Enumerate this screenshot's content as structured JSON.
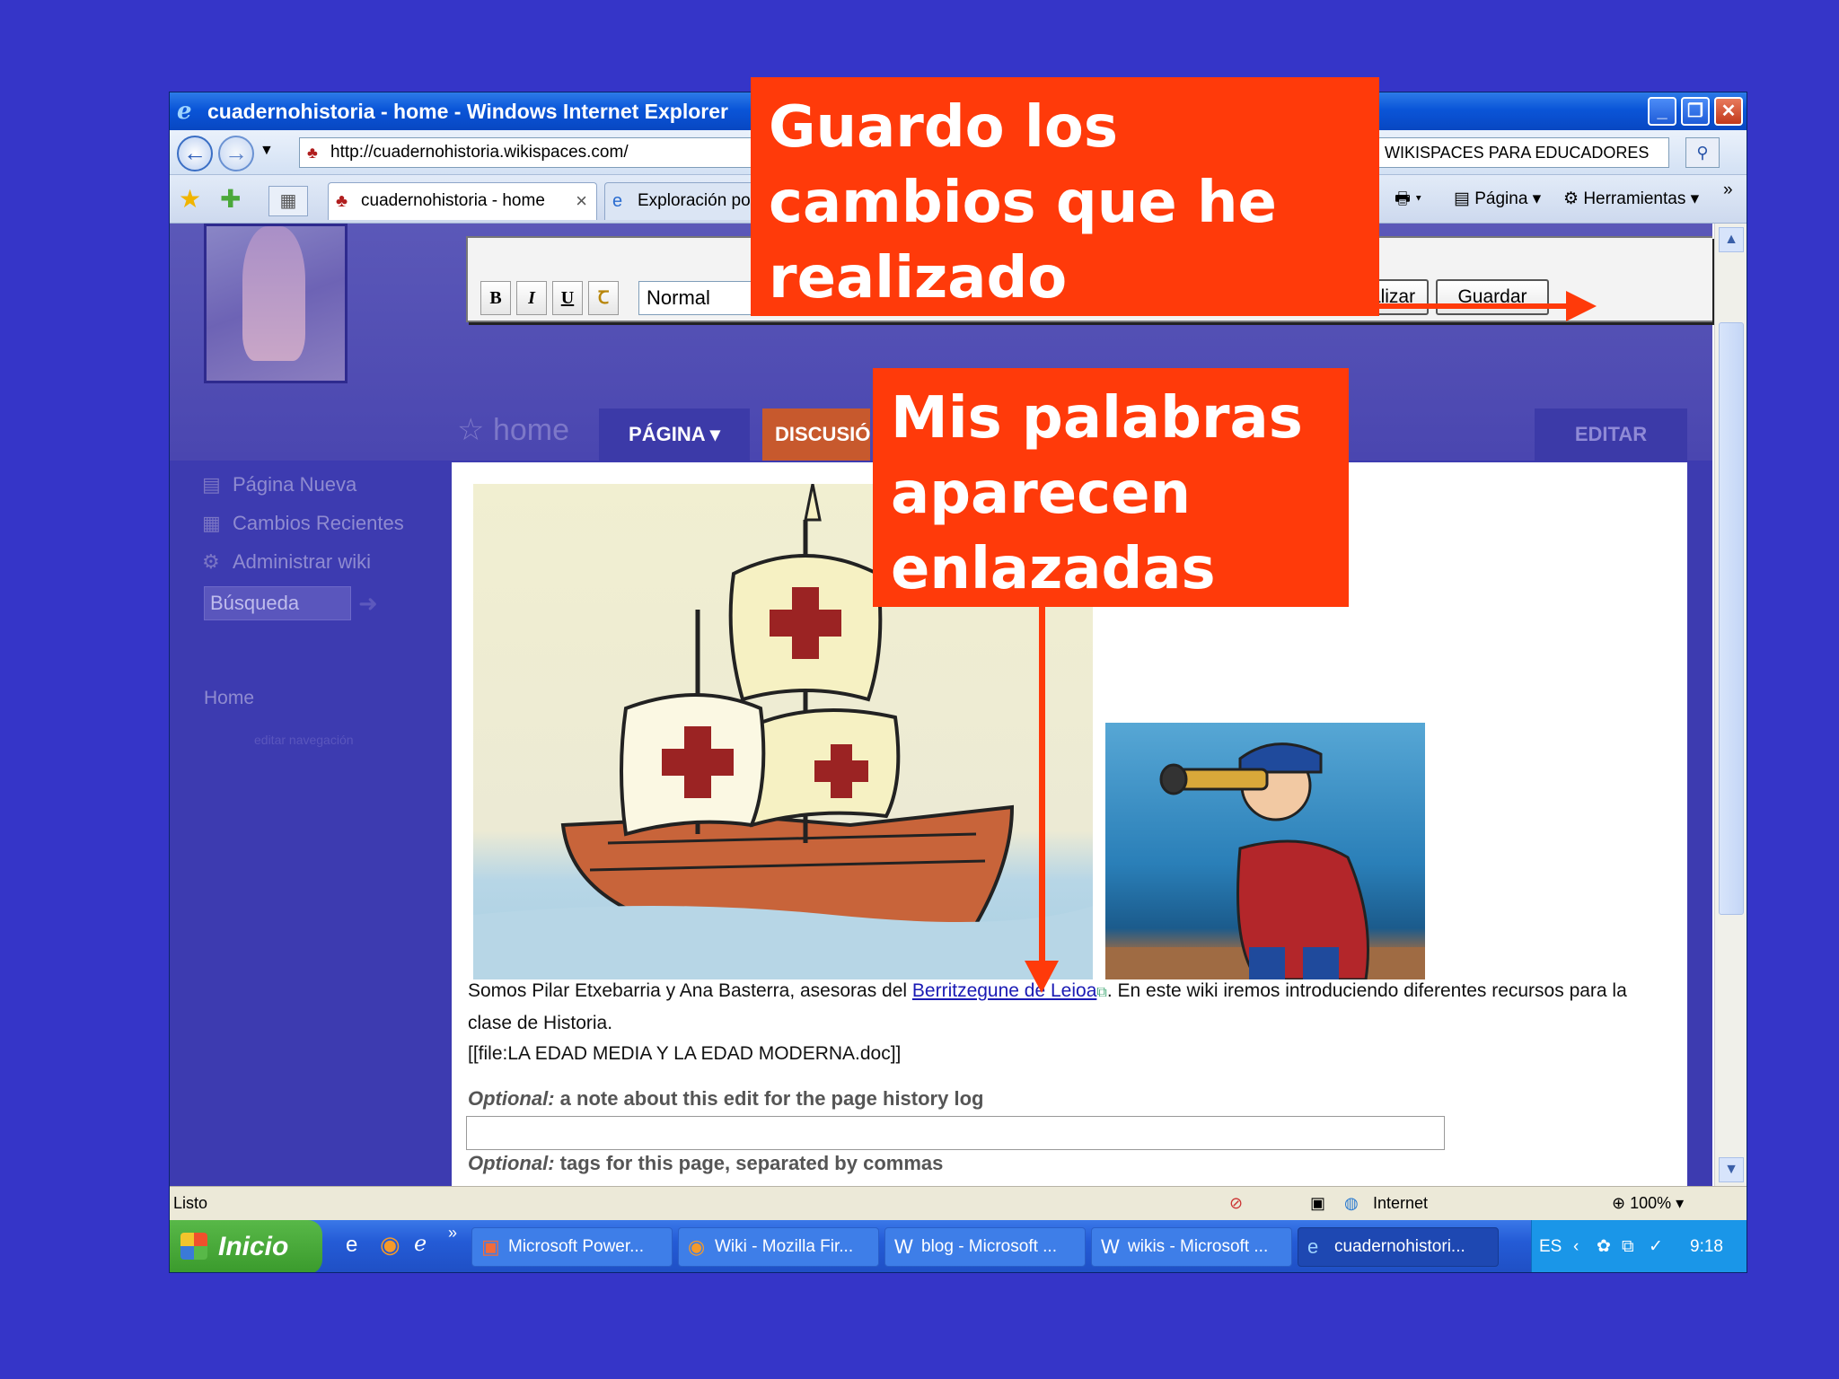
{
  "window": {
    "title": "cuadernohistoria - home - Windows Internet Explorer",
    "address": "http://cuadernohistoria.wikispaces.com/",
    "search_value": "WIKISPACES PARA EDUCADORES"
  },
  "tabs": [
    {
      "label": "cuadernohistoria - home"
    },
    {
      "label": "Exploración por"
    }
  ],
  "commands": {
    "page": "Página",
    "tools": "Herramientas"
  },
  "editor": {
    "bold": "B",
    "italic": "I",
    "underline": "U",
    "style_value": "Normal",
    "preview_label": "Previsualizar",
    "save_label": "Guardar"
  },
  "nav": {
    "home_label": "home",
    "page_tab": "PÁGINA",
    "discussion_tab": "DISCUSIÓN",
    "edit_tab": "EDITAR"
  },
  "sidebar": {
    "items": [
      {
        "label": "Página Nueva"
      },
      {
        "label": "Cambios Recientes"
      },
      {
        "label": "Administrar wiki"
      }
    ],
    "search_placeholder": "Búsqueda",
    "home_link": "Home",
    "edit_nav": "editar navegación"
  },
  "content": {
    "text_before": "Somos Pilar Etxebarria y Ana Basterra, asesoras del ",
    "link_text": "Berritzegune de Leioa",
    "text_after": ". En este wiki iremos introduciendo diferentes recursos para la clase de Historia.",
    "file_line": "[[file:LA EDAD MEDIA Y LA EDAD MODERNA.doc]]",
    "optional_prefix": "Optional:",
    "note_label": " a note about this edit for the page history log",
    "tags_label": " tags for this page, separated by commas"
  },
  "status": {
    "text": "Listo",
    "zone": "Internet",
    "zoom": "100%"
  },
  "taskbar": {
    "start": "Inicio",
    "tasks": [
      {
        "label": "Microsoft Power..."
      },
      {
        "label": "Wiki - Mozilla Fir..."
      },
      {
        "label": "blog - Microsoft ..."
      },
      {
        "label": "wikis - Microsoft ..."
      },
      {
        "label": "cuadernohistori..."
      }
    ],
    "lang": "ES",
    "clock": "9:18"
  },
  "callouts": {
    "save": "Guardo los cambios que he realizado",
    "links": "Mis palabras aparecen enlazadas"
  },
  "colors": {
    "background": "#3535c8",
    "callout": "#ff3a0a",
    "titlebar": "#0a55d8"
  }
}
